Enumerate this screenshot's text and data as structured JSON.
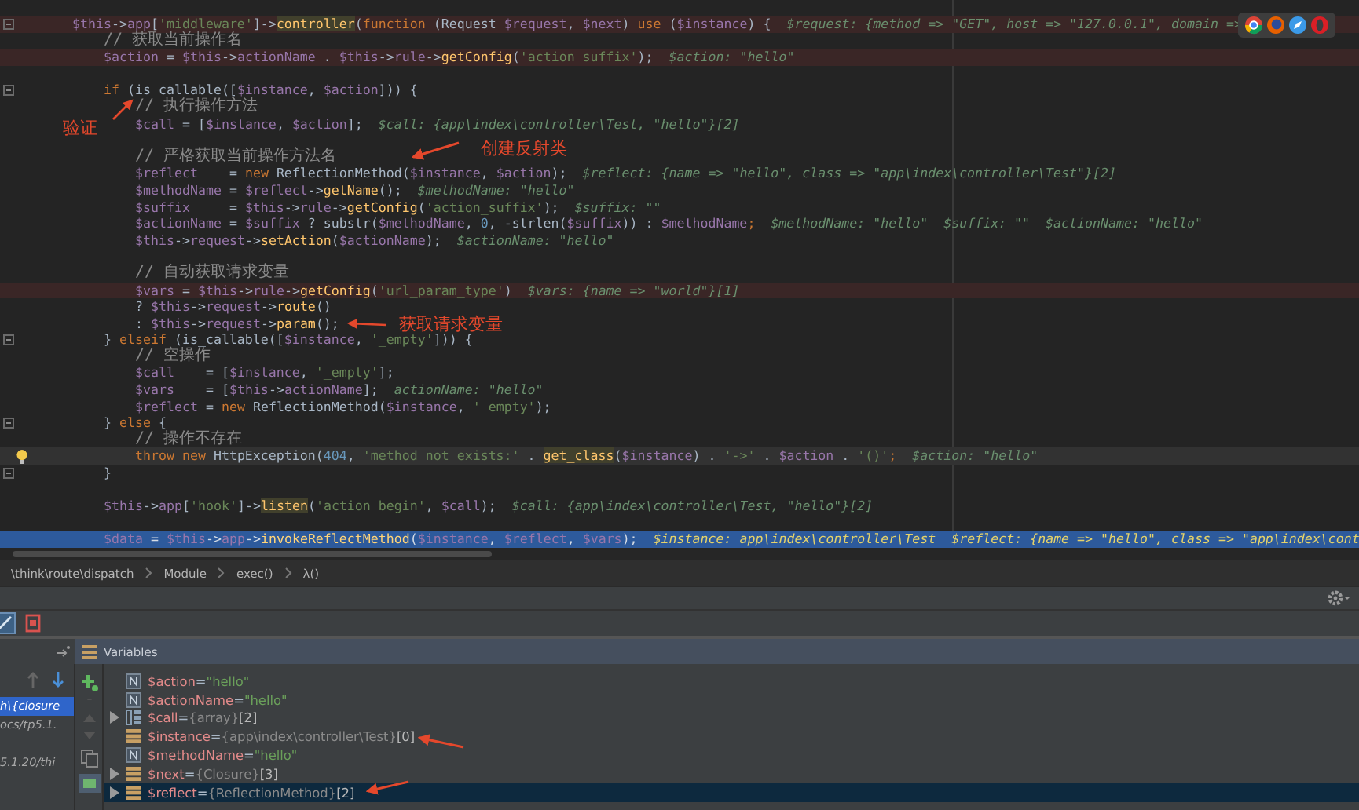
{
  "editor": {
    "lines": [
      {
        "kind": "code",
        "breakpoint": true,
        "fold": true,
        "tokens": [
          {
            "kind": "var",
            "text": "$this"
          },
          {
            "kind": "plain",
            "text": "->"
          },
          {
            "kind": "field",
            "text": "app"
          },
          {
            "kind": "plain",
            "text": "["
          },
          {
            "kind": "str",
            "text": "'middleware'"
          },
          {
            "kind": "plain",
            "text": "]->"
          },
          {
            "kind": "fnhl",
            "text": "controller"
          },
          {
            "kind": "plain",
            "text": "("
          },
          {
            "kind": "kw",
            "text": "function "
          },
          {
            "kind": "plain",
            "text": "(Request "
          },
          {
            "kind": "var",
            "text": "$request"
          },
          {
            "kind": "plain",
            "text": ", "
          },
          {
            "kind": "var",
            "text": "$next"
          },
          {
            "kind": "plain",
            "text": ") "
          },
          {
            "kind": "kw",
            "text": "use "
          },
          {
            "kind": "plain",
            "text": "("
          },
          {
            "kind": "var",
            "text": "$instance"
          },
          {
            "kind": "plain",
            "text": ") {"
          }
        ],
        "hints": [
          "$request: {method => \"GET\", host => \"127.0.0.1\", domain =>"
        ],
        "children": [
          {
            "kind": "code",
            "tokens": [
              {
                "kind": "cmt",
                "text": "// 获取当前操作名"
              }
            ]
          },
          {
            "kind": "code",
            "breakpoint": true,
            "tokens": [
              {
                "kind": "var",
                "text": "$action"
              },
              {
                "kind": "plain",
                "text": " = "
              },
              {
                "kind": "var",
                "text": "$this"
              },
              {
                "kind": "plain",
                "text": "->"
              },
              {
                "kind": "field",
                "text": "actionName"
              },
              {
                "kind": "plain",
                "text": " . "
              },
              {
                "kind": "var",
                "text": "$this"
              },
              {
                "kind": "plain",
                "text": "->"
              },
              {
                "kind": "field",
                "text": "rule"
              },
              {
                "kind": "plain",
                "text": "->"
              },
              {
                "kind": "fn",
                "text": "getConfig"
              },
              {
                "kind": "plain",
                "text": "("
              },
              {
                "kind": "str",
                "text": "'action_suffix'"
              },
              {
                "kind": "plain",
                "text": ");"
              }
            ],
            "hints": [
              "$action: \"hello\""
            ]
          },
          {
            "kind": "blank"
          },
          {
            "kind": "code",
            "fold": true,
            "tokens": [
              {
                "kind": "kw",
                "text": "if "
              },
              {
                "kind": "plain",
                "text": "(is_callable(["
              },
              {
                "kind": "var",
                "text": "$instance"
              },
              {
                "kind": "plain",
                "text": ", "
              },
              {
                "kind": "var",
                "text": "$action"
              },
              {
                "kind": "plain",
                "text": "])) {"
              }
            ],
            "children": [
              {
                "kind": "code",
                "tokens": [
                  {
                    "kind": "cmt",
                    "text": "// 执行操作方法"
                  }
                ]
              },
              {
                "kind": "code",
                "tokens": [
                  {
                    "kind": "var",
                    "text": "$call"
                  },
                  {
                    "kind": "plain",
                    "text": " = ["
                  },
                  {
                    "kind": "var",
                    "text": "$instance"
                  },
                  {
                    "kind": "plain",
                    "text": ", "
                  },
                  {
                    "kind": "var",
                    "text": "$action"
                  },
                  {
                    "kind": "plain",
                    "text": "];"
                  }
                ],
                "hints": [
                  "$call: {app\\index\\controller\\Test, \"hello\"}[2]"
                ]
              },
              {
                "kind": "blank"
              },
              {
                "kind": "code",
                "tokens": [
                  {
                    "kind": "cmt",
                    "text": "// 严格获取当前操作方法名"
                  }
                ]
              },
              {
                "kind": "code",
                "tokens": [
                  {
                    "kind": "var",
                    "text": "$reflect"
                  },
                  {
                    "kind": "plain",
                    "text": "    = "
                  },
                  {
                    "kind": "kw",
                    "text": "new "
                  },
                  {
                    "kind": "plain",
                    "text": "ReflectionMethod("
                  },
                  {
                    "kind": "var",
                    "text": "$instance"
                  },
                  {
                    "kind": "plain",
                    "text": ", "
                  },
                  {
                    "kind": "var",
                    "text": "$action"
                  },
                  {
                    "kind": "plain",
                    "text": ");"
                  }
                ],
                "hints": [
                  "$reflect: {name => \"hello\", class => \"app\\index\\controller\\Test\"}[2]"
                ]
              },
              {
                "kind": "code",
                "tokens": [
                  {
                    "kind": "var",
                    "text": "$methodName"
                  },
                  {
                    "kind": "plain",
                    "text": " = "
                  },
                  {
                    "kind": "var",
                    "text": "$reflect"
                  },
                  {
                    "kind": "plain",
                    "text": "->"
                  },
                  {
                    "kind": "fn",
                    "text": "getName"
                  },
                  {
                    "kind": "plain",
                    "text": "();"
                  }
                ],
                "hints": [
                  "$methodName: \"hello\""
                ]
              },
              {
                "kind": "code",
                "tokens": [
                  {
                    "kind": "var",
                    "text": "$suffix"
                  },
                  {
                    "kind": "plain",
                    "text": "     = "
                  },
                  {
                    "kind": "var",
                    "text": "$this"
                  },
                  {
                    "kind": "plain",
                    "text": "->"
                  },
                  {
                    "kind": "field",
                    "text": "rule"
                  },
                  {
                    "kind": "plain",
                    "text": "->"
                  },
                  {
                    "kind": "fn",
                    "text": "getConfig"
                  },
                  {
                    "kind": "plain",
                    "text": "("
                  },
                  {
                    "kind": "str",
                    "text": "'action_suffix'"
                  },
                  {
                    "kind": "plain",
                    "text": ");"
                  }
                ],
                "hints": [
                  "$suffix: \"\""
                ]
              },
              {
                "kind": "code",
                "tokens": [
                  {
                    "kind": "var",
                    "text": "$actionName"
                  },
                  {
                    "kind": "plain",
                    "text": " = "
                  },
                  {
                    "kind": "var",
                    "text": "$suffix"
                  },
                  {
                    "kind": "plain",
                    "text": " ? substr("
                  },
                  {
                    "kind": "var",
                    "text": "$methodName"
                  },
                  {
                    "kind": "plain",
                    "text": ", "
                  },
                  {
                    "kind": "num",
                    "text": "0"
                  },
                  {
                    "kind": "plain",
                    "text": ", -strlen("
                  },
                  {
                    "kind": "var",
                    "text": "$suffix"
                  },
                  {
                    "kind": "plain",
                    "text": ")) : "
                  },
                  {
                    "kind": "var",
                    "text": "$methodName"
                  },
                  {
                    "kind": "kw",
                    "text": ";"
                  }
                ],
                "hints": [
                  "$methodName: \"hello\"",
                  "$suffix: \"\"",
                  "$actionName: \"hello\""
                ]
              },
              {
                "kind": "code",
                "tokens": [
                  {
                    "kind": "var",
                    "text": "$this"
                  },
                  {
                    "kind": "plain",
                    "text": "->"
                  },
                  {
                    "kind": "field",
                    "text": "request"
                  },
                  {
                    "kind": "plain",
                    "text": "->"
                  },
                  {
                    "kind": "fn",
                    "text": "setAction"
                  },
                  {
                    "kind": "plain",
                    "text": "("
                  },
                  {
                    "kind": "var",
                    "text": "$actionName"
                  },
                  {
                    "kind": "plain",
                    "text": ");"
                  }
                ],
                "hints": [
                  "$actionName: \"hello\""
                ]
              },
              {
                "kind": "blank"
              },
              {
                "kind": "code",
                "tokens": [
                  {
                    "kind": "cmt",
                    "text": "// 自动获取请求变量"
                  }
                ]
              },
              {
                "kind": "code",
                "breakpoint": true,
                "tokens": [
                  {
                    "kind": "var",
                    "text": "$vars"
                  },
                  {
                    "kind": "plain",
                    "text": " = "
                  },
                  {
                    "kind": "var",
                    "text": "$this"
                  },
                  {
                    "kind": "plain",
                    "text": "->"
                  },
                  {
                    "kind": "field",
                    "text": "rule"
                  },
                  {
                    "kind": "plain",
                    "text": "->"
                  },
                  {
                    "kind": "fn",
                    "text": "getConfig"
                  },
                  {
                    "kind": "plain",
                    "text": "("
                  },
                  {
                    "kind": "str",
                    "text": "'url_param_type'"
                  },
                  {
                    "kind": "plain",
                    "text": ")"
                  }
                ],
                "hints": [
                  "$vars: {name => \"world\"}[1]"
                ]
              },
              {
                "kind": "code",
                "tokens": [
                  {
                    "kind": "plain",
                    "text": "? "
                  },
                  {
                    "kind": "var",
                    "text": "$this"
                  },
                  {
                    "kind": "plain",
                    "text": "->"
                  },
                  {
                    "kind": "field",
                    "text": "request"
                  },
                  {
                    "kind": "plain",
                    "text": "->"
                  },
                  {
                    "kind": "fn",
                    "text": "route"
                  },
                  {
                    "kind": "plain",
                    "text": "()"
                  }
                ]
              },
              {
                "kind": "code",
                "tokens": [
                  {
                    "kind": "plain",
                    "text": ": "
                  },
                  {
                    "kind": "var",
                    "text": "$this"
                  },
                  {
                    "kind": "plain",
                    "text": "->"
                  },
                  {
                    "kind": "field",
                    "text": "request"
                  },
                  {
                    "kind": "plain",
                    "text": "->"
                  },
                  {
                    "kind": "fn",
                    "text": "param"
                  },
                  {
                    "kind": "plain",
                    "text": "();"
                  }
                ]
              }
            ]
          },
          {
            "kind": "code",
            "fold": true,
            "tokens": [
              {
                "kind": "plain",
                "text": "} "
              },
              {
                "kind": "kw",
                "text": "elseif "
              },
              {
                "kind": "plain",
                "text": "(is_callable(["
              },
              {
                "kind": "var",
                "text": "$instance"
              },
              {
                "kind": "plain",
                "text": ", "
              },
              {
                "kind": "str",
                "text": "'_empty'"
              },
              {
                "kind": "plain",
                "text": "])) {"
              }
            ],
            "children": [
              {
                "kind": "code",
                "tokens": [
                  {
                    "kind": "cmt",
                    "text": "// 空操作"
                  }
                ]
              },
              {
                "kind": "code",
                "tokens": [
                  {
                    "kind": "var",
                    "text": "$call"
                  },
                  {
                    "kind": "plain",
                    "text": "    = ["
                  },
                  {
                    "kind": "var",
                    "text": "$instance"
                  },
                  {
                    "kind": "plain",
                    "text": ", "
                  },
                  {
                    "kind": "str",
                    "text": "'_empty'"
                  },
                  {
                    "kind": "plain",
                    "text": "];"
                  }
                ]
              },
              {
                "kind": "code",
                "tokens": [
                  {
                    "kind": "var",
                    "text": "$vars"
                  },
                  {
                    "kind": "plain",
                    "text": "    = ["
                  },
                  {
                    "kind": "var",
                    "text": "$this"
                  },
                  {
                    "kind": "plain",
                    "text": "->"
                  },
                  {
                    "kind": "field",
                    "text": "actionName"
                  },
                  {
                    "kind": "plain",
                    "text": "];"
                  }
                ],
                "hints": [
                  "actionName: \"hello\""
                ]
              },
              {
                "kind": "code",
                "tokens": [
                  {
                    "kind": "var",
                    "text": "$reflect"
                  },
                  {
                    "kind": "plain",
                    "text": " = "
                  },
                  {
                    "kind": "kw",
                    "text": "new "
                  },
                  {
                    "kind": "plain",
                    "text": "ReflectionMethod("
                  },
                  {
                    "kind": "var",
                    "text": "$instance"
                  },
                  {
                    "kind": "plain",
                    "text": ", "
                  },
                  {
                    "kind": "str",
                    "text": "'_empty'"
                  },
                  {
                    "kind": "plain",
                    "text": ");"
                  }
                ]
              }
            ]
          },
          {
            "kind": "code",
            "fold": true,
            "tokens": [
              {
                "kind": "plain",
                "text": "} "
              },
              {
                "kind": "kw",
                "text": "else "
              },
              {
                "kind": "plain",
                "text": "{"
              }
            ],
            "children": [
              {
                "kind": "code",
                "tokens": [
                  {
                    "kind": "cmt",
                    "text": "// 操作不存在"
                  }
                ]
              },
              {
                "kind": "code",
                "caret_line": true,
                "bulb": true,
                "tokens": [
                  {
                    "kind": "kw",
                    "text": "throw new "
                  },
                  {
                    "kind": "plain",
                    "text": "HttpException("
                  },
                  {
                    "kind": "num",
                    "text": "404"
                  },
                  {
                    "kind": "plain",
                    "text": ", "
                  },
                  {
                    "kind": "str",
                    "text": "'method not exists:'"
                  },
                  {
                    "kind": "plain",
                    "text": " . "
                  },
                  {
                    "kind": "fnhl",
                    "text": "get_class"
                  },
                  {
                    "kind": "plain",
                    "text": "("
                  },
                  {
                    "kind": "var",
                    "text": "$instance"
                  },
                  {
                    "kind": "plain",
                    "text": ") . "
                  },
                  {
                    "kind": "str",
                    "text": "'->'"
                  },
                  {
                    "kind": "plain",
                    "text": " . "
                  },
                  {
                    "kind": "var",
                    "text": "$action"
                  },
                  {
                    "kind": "plain",
                    "text": " . "
                  },
                  {
                    "kind": "str",
                    "text": "'()'"
                  },
                  {
                    "kind": "kw",
                    "text": ";"
                  }
                ],
                "hints": [
                  "$action: \"hello\""
                ]
              }
            ]
          },
          {
            "kind": "code",
            "fold": true,
            "tokens": [
              {
                "kind": "plain",
                "text": "}"
              }
            ]
          },
          {
            "kind": "blank"
          },
          {
            "kind": "code",
            "tokens": [
              {
                "kind": "var",
                "text": "$this"
              },
              {
                "kind": "plain",
                "text": "->"
              },
              {
                "kind": "field",
                "text": "app"
              },
              {
                "kind": "plain",
                "text": "["
              },
              {
                "kind": "str",
                "text": "'hook'"
              },
              {
                "kind": "plain",
                "text": "]->"
              },
              {
                "kind": "fnhl",
                "text": "listen"
              },
              {
                "kind": "plain",
                "text": "("
              },
              {
                "kind": "str",
                "text": "'action_begin'"
              },
              {
                "kind": "plain",
                "text": ", "
              },
              {
                "kind": "var",
                "text": "$call"
              },
              {
                "kind": "plain",
                "text": ");"
              }
            ],
            "hints": [
              "$call: {app\\index\\controller\\Test, \"hello\"}[2]"
            ]
          },
          {
            "kind": "blank"
          },
          {
            "kind": "code",
            "execution_point": true,
            "tokens": [
              {
                "kind": "var",
                "text": "$data"
              },
              {
                "kind": "plain",
                "text": " = "
              },
              {
                "kind": "var",
                "text": "$this"
              },
              {
                "kind": "plain",
                "text": "->"
              },
              {
                "kind": "field",
                "text": "app"
              },
              {
                "kind": "plain",
                "text": "->"
              },
              {
                "kind": "fn",
                "text": "invokeReflectMethod"
              },
              {
                "kind": "plain",
                "text": "("
              },
              {
                "kind": "var",
                "text": "$instance"
              },
              {
                "kind": "plain",
                "text": ", "
              },
              {
                "kind": "var",
                "text": "$reflect"
              },
              {
                "kind": "plain",
                "text": ", "
              },
              {
                "kind": "var",
                "text": "$vars"
              },
              {
                "kind": "plain",
                "text": ");"
              }
            ],
            "hints": [
              "$instance: app\\index\\controller\\Test  $reflect: {name => \"hello\", class => \"app\\index\\cont"
            ]
          }
        ]
      }
    ]
  },
  "annotations": [
    {
      "text": "验证"
    },
    {
      "text": "创建反射类"
    },
    {
      "text": "获取请求变量"
    }
  ],
  "breadcrumb": [
    "\\think\\route\\dispatch",
    "Module",
    "exec()",
    "λ()"
  ],
  "debugger": {
    "variables_title": "Variables",
    "frames": [
      {
        "label": "h\\{closure",
        "selected": true
      },
      {
        "label": "ocs/tp5.1.",
        "selected": false
      },
      {
        "label": "5.1.20/thi",
        "selected": false
      }
    ],
    "variables": [
      {
        "kind": "string",
        "name": "$action",
        "assign": "=",
        "value": "\"hello\"",
        "expandable": false,
        "selected": false
      },
      {
        "kind": "string",
        "name": "$actionName",
        "assign": "=",
        "value": "\"hello\"",
        "expandable": false,
        "selected": false
      },
      {
        "kind": "array",
        "name": "$call",
        "assign": "=",
        "value": "{array}",
        "count": "[2]",
        "expandable": true,
        "selected": false
      },
      {
        "kind": "object",
        "name": "$instance",
        "assign": "=",
        "value": "{app\\index\\controller\\Test}",
        "count": "[0]",
        "expandable": false,
        "selected": false
      },
      {
        "kind": "string",
        "name": "$methodName",
        "assign": "=",
        "value": "\"hello\"",
        "expandable": false,
        "selected": false
      },
      {
        "kind": "object",
        "name": "$next",
        "assign": "=",
        "value": "{Closure}",
        "count": "[3]",
        "expandable": true,
        "selected": false
      },
      {
        "kind": "object",
        "name": "$reflect",
        "assign": "=",
        "value": "{ReflectionMethod}",
        "count": "[2]",
        "expandable": true,
        "selected": true
      }
    ]
  }
}
